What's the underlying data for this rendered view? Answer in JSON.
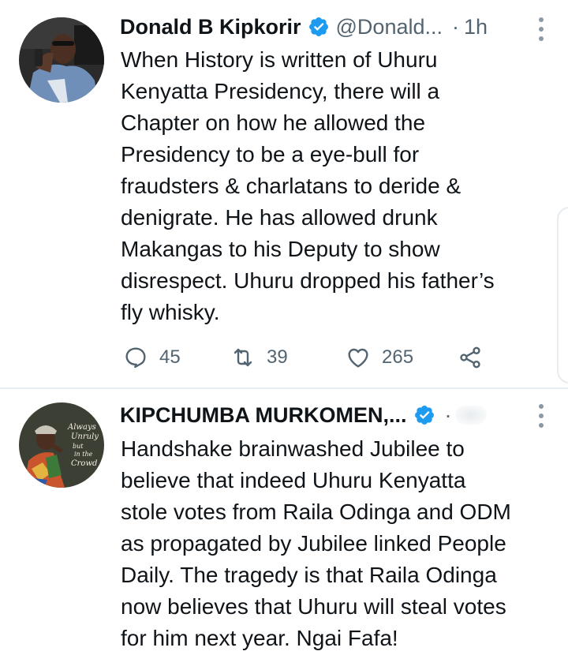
{
  "tweets": [
    {
      "author_name": "Donald B Kipkorir",
      "handle": "@Donald...",
      "separator": "·",
      "time": "1h",
      "lines": [
        "When History is written of Uhuru",
        "Kenyatta Presidency, there will a",
        "Chapter on how he allowed the",
        "Presidency to be a eye-bull for",
        "fraudsters & charlatans to deride &",
        "denigrate. He has allowed drunk",
        "Makangas to his Deputy to show",
        "disrespect. Uhuru dropped his father’s",
        "fly whisky."
      ],
      "replies": "45",
      "retweets": "39",
      "likes": "265"
    },
    {
      "author_name": "KIPCHUMBA MURKOMEN,...",
      "separator": "·",
      "avatar_text": "Always Unruly but in the Crowd",
      "lines": [
        "Handshake brainwashed Jubilee to",
        "believe that indeed Uhuru Kenyatta",
        "stole votes from Raila Odinga and ODM",
        "as propagated by Jubilee linked People",
        "Daily. The tragedy is that Raila Odinga",
        "now believes that Uhuru will steal votes",
        "for him next year. Ngai Fafa!"
      ]
    }
  ],
  "icons": {
    "reply": "reply-icon",
    "retweet": "retweet-icon",
    "like": "like-icon",
    "share": "share-icon",
    "verified": "verified-badge-icon",
    "more": "more-options-icon"
  },
  "colors": {
    "verified_blue": "#1d9bf0",
    "text": "#0f1419",
    "secondary": "#536471",
    "divider": "#e6ecf0"
  }
}
